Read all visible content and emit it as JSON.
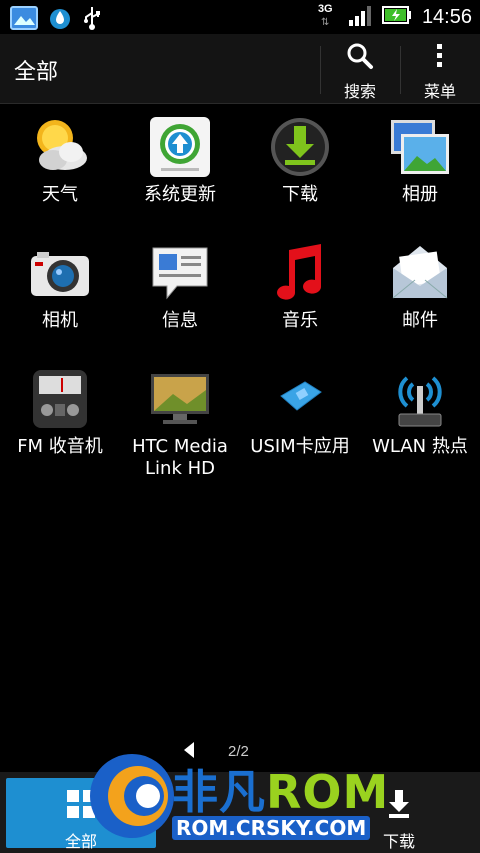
{
  "status_bar": {
    "network": "3G",
    "time": "14:56",
    "icons": [
      "gallery-icon",
      "drop-icon",
      "usb-icon",
      "signal-icon",
      "battery-charging-icon"
    ]
  },
  "action_bar": {
    "title": "全部",
    "search_label": "搜索",
    "menu_label": "菜单"
  },
  "apps": [
    {
      "label": "天气",
      "icon": "weather-icon"
    },
    {
      "label": "系统更新",
      "icon": "system-update-icon"
    },
    {
      "label": "下载",
      "icon": "download-icon"
    },
    {
      "label": "相册",
      "icon": "gallery-icon"
    },
    {
      "label": "相机",
      "icon": "camera-icon"
    },
    {
      "label": "信息",
      "icon": "messages-icon"
    },
    {
      "label": "音乐",
      "icon": "music-icon"
    },
    {
      "label": "邮件",
      "icon": "mail-icon"
    },
    {
      "label": "FM 收音机",
      "icon": "fm-radio-icon"
    },
    {
      "label": "HTC Media Link HD",
      "icon": "media-link-icon"
    },
    {
      "label": "USIM卡应用",
      "icon": "sim-card-icon"
    },
    {
      "label": "WLAN 热点",
      "icon": "wlan-hotspot-icon"
    }
  ],
  "pager": {
    "text": "2/2"
  },
  "tabs": {
    "all_label": "全部",
    "download_label": "下载"
  },
  "watermark": {
    "brand": "非凡",
    "rom": "ROM",
    "url": "ROM.CRSKY.COM"
  },
  "colors": {
    "accent": "#1e8fd1",
    "action_bar": "#141414",
    "background": "#000000"
  }
}
